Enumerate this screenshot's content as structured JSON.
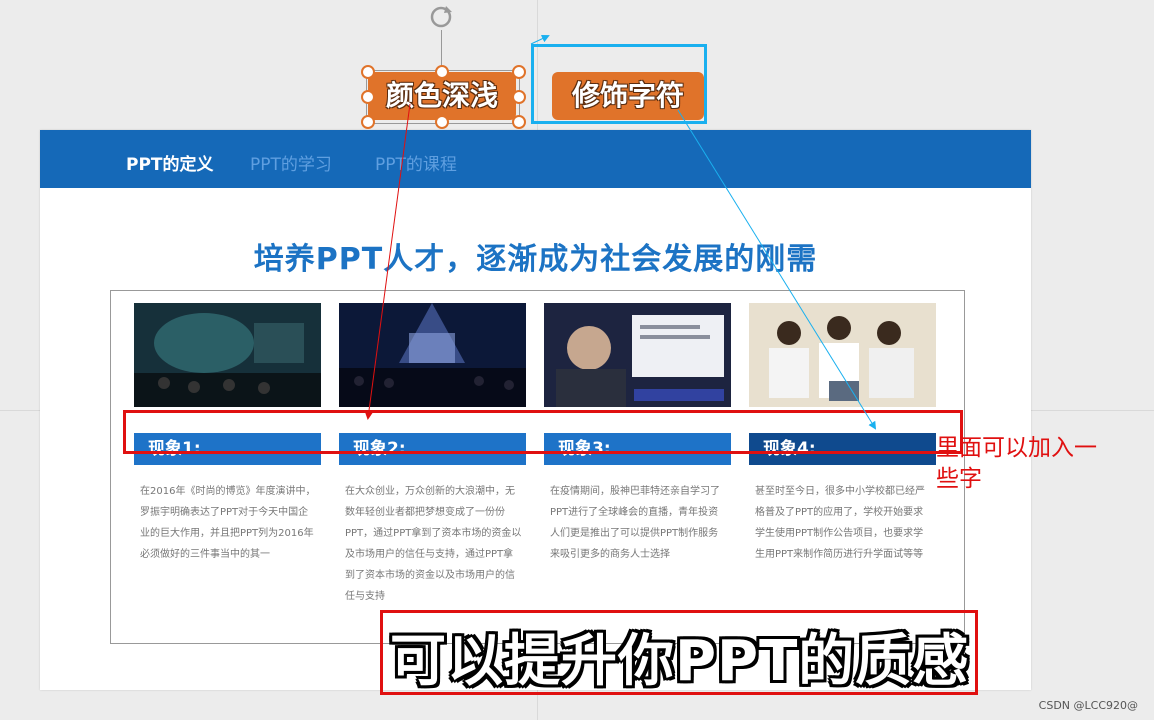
{
  "slide": {
    "nav": [
      "PPT的定义",
      "PPT的学习",
      "PPT的课程"
    ],
    "title": "培养PPT人才，逐渐成为社会发展的刚需",
    "cards": [
      {
        "label": "现象1:",
        "text": "在2016年《时尚的博览》年度演讲中，罗振宇明确表达了PPT对于今天中国企业的巨大作用，并且把PPT列为2016年必须做好的三件事当中的其一",
        "photo_icon": "conference-stage-photo"
      },
      {
        "label": "现象2:",
        "text": "在大众创业，万众创新的大浪潮中，无数年轻创业者都把梦想变成了一份份PPT，通过PPT拿到了资本市场的资金以及市场用户的信任与支持，通过PPT拿到了资本市场的资金以及市场用户的信任与支持",
        "photo_icon": "crowd-event-photo"
      },
      {
        "label": "现象3:",
        "text": "在疫情期间，股神巴菲特还亲自学习了PPT进行了全球峰会的直播，青年投资人们更是推出了可以提供PPT制作服务来吸引更多的商务人士选择",
        "photo_icon": "presenter-photo"
      },
      {
        "label": "现象4:",
        "text": "甚至时至今日，很多中小学校都已经严格普及了PPT的应用了，学校开始要求学生使用PPT制作公告项目，也要求学生用PPT来制作简历进行升学面试等等",
        "photo_icon": "students-photo"
      }
    ]
  },
  "tags": {
    "selected": "颜色深浅",
    "boxed": "修饰字符"
  },
  "annotation": "里面可以加入一些字",
  "subtitle": "可以提升你PPT的质感",
  "watermark": "CSDN @LCC920@",
  "colors": {
    "nav_bg": "#1569b8",
    "title": "#1c73c4",
    "tag": "#e0732a",
    "annotation": "#e01010",
    "blue_frame": "#1ab0ef"
  }
}
